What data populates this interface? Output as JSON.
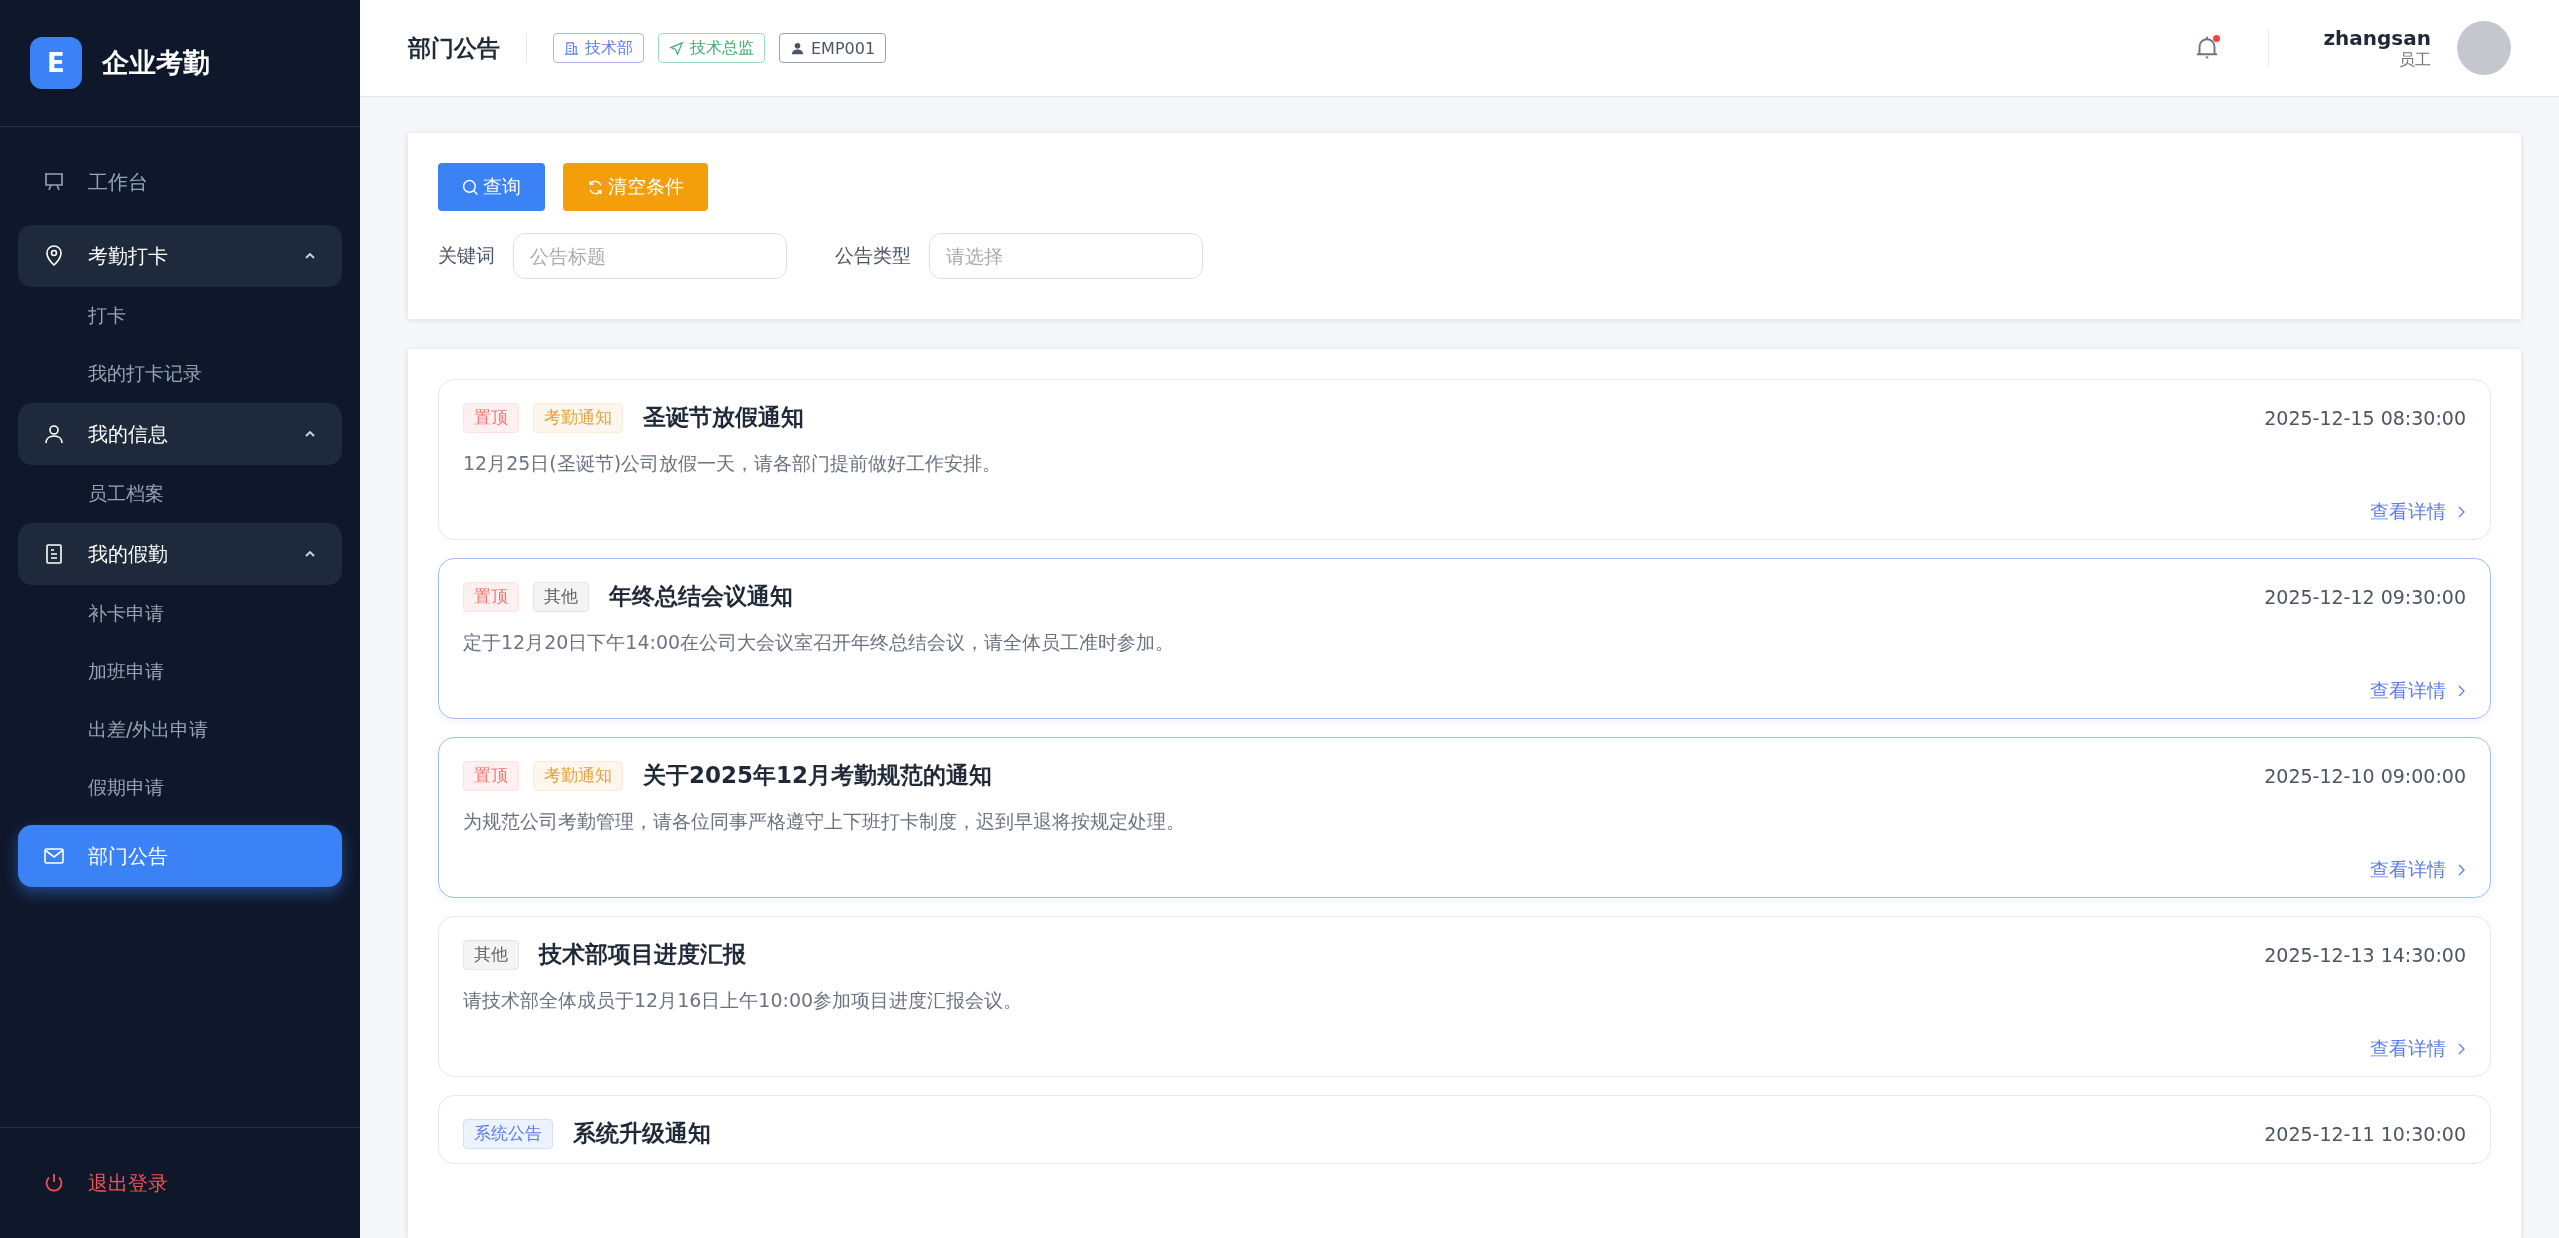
{
  "brand": {
    "logo": "E",
    "name": "企业考勤"
  },
  "sidebar": {
    "items": [
      {
        "kind": "link",
        "label": "工作台",
        "selected": false
      },
      {
        "kind": "group",
        "label": "考勤打卡",
        "expanded": true,
        "children": [
          {
            "label": "打卡",
            "selected": false
          },
          {
            "label": "我的打卡记录",
            "selected": false
          }
        ]
      },
      {
        "kind": "group",
        "label": "我的信息",
        "expanded": true,
        "children": [
          {
            "label": "员工档案",
            "selected": false
          }
        ]
      },
      {
        "kind": "group",
        "label": "我的假勤",
        "expanded": true,
        "children": [
          {
            "label": "补卡申请",
            "selected": false
          },
          {
            "label": "加班申请",
            "selected": false
          },
          {
            "label": "出差/外出申请",
            "selected": false
          },
          {
            "label": "假期申请",
            "selected": false
          }
        ]
      },
      {
        "kind": "link",
        "label": "部门公告",
        "selected": true
      }
    ],
    "logout": "退出登录"
  },
  "header": {
    "title": "部门公告",
    "badges": [
      {
        "kind": "department",
        "label": "技术部"
      },
      {
        "kind": "position",
        "label": "技术总监"
      },
      {
        "kind": "employee",
        "label": "EMP001"
      }
    ],
    "notification_unread": true,
    "user": {
      "name": "zhangsan",
      "role": "员工"
    }
  },
  "filter": {
    "buttons": [
      {
        "kind": "primary",
        "label": "查询"
      },
      {
        "kind": "warning",
        "label": "清空条件"
      }
    ],
    "fields": [
      {
        "label": "关键词",
        "placeholder": "公告标题"
      },
      {
        "label": "公告类型",
        "placeholder": "请选择"
      }
    ]
  },
  "notices": [
    {
      "tags": [
        {
          "kind": "pinned",
          "label": "置顶"
        },
        {
          "kind": "attendance",
          "label": "考勤通知"
        }
      ],
      "title": "圣诞节放假通知",
      "time": "2025-12-15 08:30:00",
      "summary": "12月25日(圣诞节)公司放假一天，请各部门提前做好工作安排。",
      "link": "查看详情",
      "highlighted": false
    },
    {
      "tags": [
        {
          "kind": "pinned",
          "label": "置顶"
        },
        {
          "kind": "other",
          "label": "其他"
        }
      ],
      "title": "年终总结会议通知",
      "time": "2025-12-12 09:30:00",
      "summary": "定于12月20日下午14:00在公司大会议室召开年终总结会议，请全体员工准时参加。",
      "link": "查看详情",
      "highlighted": true
    },
    {
      "tags": [
        {
          "kind": "pinned",
          "label": "置顶"
        },
        {
          "kind": "attendance",
          "label": "考勤通知"
        }
      ],
      "title": "关于2025年12月考勤规范的通知",
      "time": "2025-12-10 09:00:00",
      "summary": "为规范公司考勤管理，请各位同事严格遵守上下班打卡制度，迟到早退将按规定处理。",
      "link": "查看详情",
      "highlighted": true
    },
    {
      "tags": [
        {
          "kind": "other",
          "label": "其他"
        }
      ],
      "title": "技术部项目进度汇报",
      "time": "2025-12-13 14:30:00",
      "summary": "请技术部全体成员于12月16日上午10:00参加项目进度汇报会议。",
      "link": "查看详情",
      "highlighted": false
    },
    {
      "tags": [
        {
          "kind": "system",
          "label": "系统公告"
        }
      ],
      "title": "系统升级通知",
      "time": "2025-12-11 10:30:00",
      "highlighted": false
    }
  ]
}
